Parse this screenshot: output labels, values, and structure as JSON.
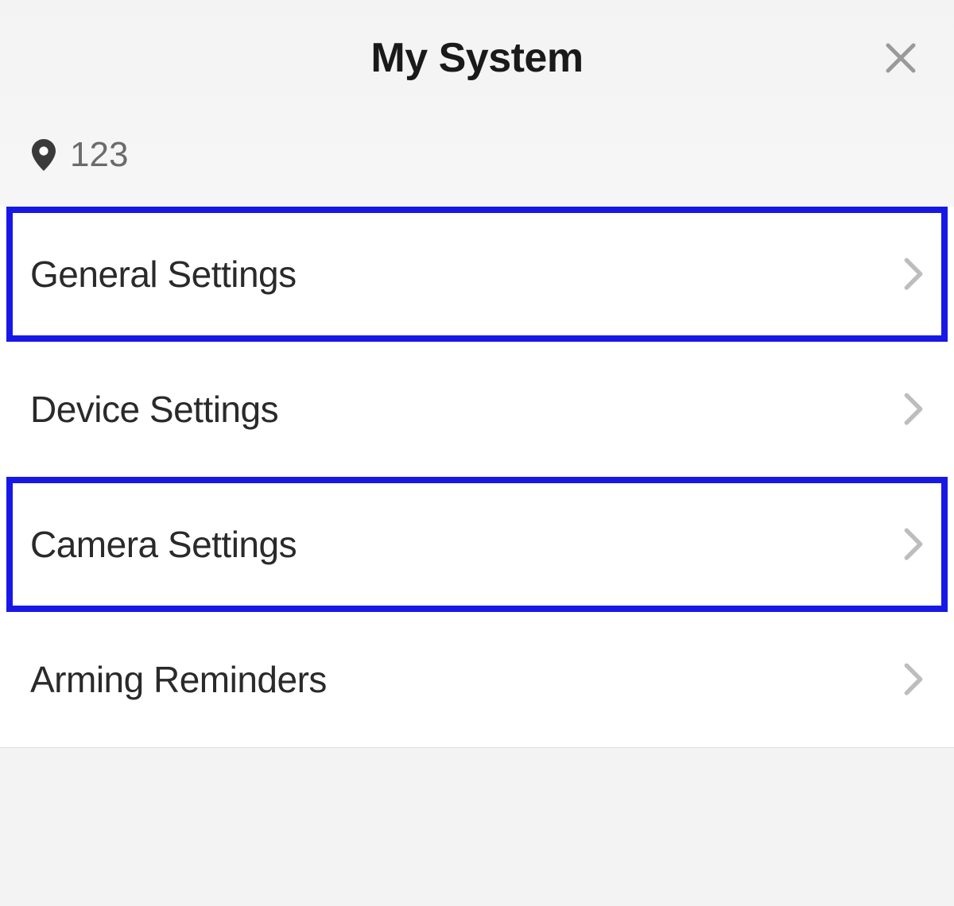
{
  "header": {
    "title": "My System"
  },
  "location": {
    "text": "123"
  },
  "settings": {
    "items": [
      {
        "label": "General Settings",
        "highlighted": true
      },
      {
        "label": "Device Settings",
        "highlighted": false
      },
      {
        "label": "Camera Settings",
        "highlighted": true
      },
      {
        "label": "Arming Reminders",
        "highlighted": false
      }
    ]
  },
  "colors": {
    "highlight": "#1818e6",
    "chevron": "#bdbdbd",
    "close": "#9a9a9a"
  }
}
